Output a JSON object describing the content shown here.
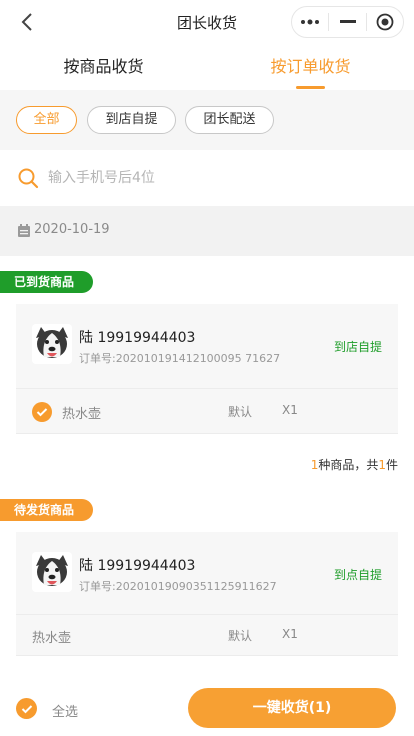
{
  "nav": {
    "title": "团长收货"
  },
  "tabs": [
    {
      "label": "按商品收货",
      "active": false
    },
    {
      "label": "按订单收货",
      "active": true
    }
  ],
  "filters": [
    {
      "label": "全部",
      "active": true
    },
    {
      "label": "到店自提",
      "active": false
    },
    {
      "label": "团长配送",
      "active": false
    }
  ],
  "search": {
    "placeholder": "输入手机号后4位",
    "value": ""
  },
  "date": "2020-10-19",
  "sections": [
    {
      "badge": "已到货商品",
      "orders": [
        {
          "customer": "陆 19919944403",
          "order_no": "订单号:202010191412100095 71627",
          "pickup": "到店自提",
          "items": [
            {
              "name": "热水壶",
              "spec": "默认",
              "qty": "X1",
              "checked": true
            }
          ]
        }
      ]
    },
    {
      "badge": "待发货商品",
      "orders": [
        {
          "customer": "陆 19919944403",
          "order_no": "订单号:20201019090351125911627",
          "pickup": "到点自提",
          "items": [
            {
              "name": "热水壶",
              "spec": "默认",
              "qty": "X1",
              "checked": false
            }
          ]
        }
      ]
    }
  ],
  "summary": {
    "kinds": "1",
    "kinds_suffix": "种商品，共",
    "total": "1",
    "total_suffix": "件"
  },
  "footer": {
    "select_all": "全选",
    "confirm": "一键收货(1)"
  },
  "colors": {
    "accent": "#f79b2e",
    "green": "#1f9d2a"
  },
  "icons": {
    "back": "chevron-left-icon",
    "search": "search-icon",
    "calendar": "calendar-icon",
    "check": "check-icon"
  }
}
